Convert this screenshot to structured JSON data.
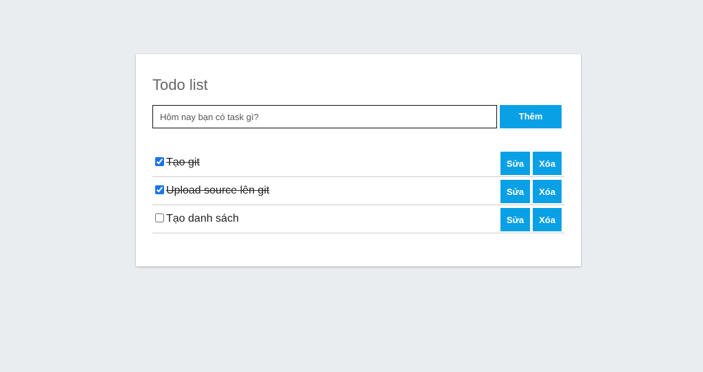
{
  "app": {
    "title": "Todo list"
  },
  "form": {
    "input_placeholder": "Hôm nay bạn có task gì?",
    "input_value": "",
    "add_label": "Thêm"
  },
  "todos": [
    {
      "label": "Tạo git",
      "done": true,
      "edit_label": "Sửa",
      "delete_label": "Xóa"
    },
    {
      "label": "Upload source lên git",
      "done": true,
      "edit_label": "Sửa",
      "delete_label": "Xóa"
    },
    {
      "label": "Tạo danh sách",
      "done": false,
      "edit_label": "Sửa",
      "delete_label": "Xóa"
    }
  ],
  "colors": {
    "accent": "#0aa0e6",
    "background": "#e9edf0",
    "card": "#ffffff",
    "title": "#666666"
  }
}
